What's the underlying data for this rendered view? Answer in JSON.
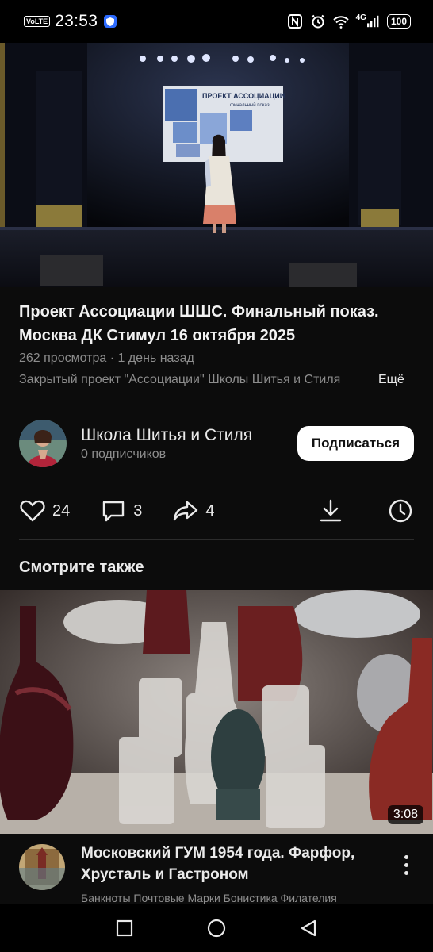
{
  "status_bar": {
    "volte": "VoLTE",
    "time": "23:53",
    "network": "4G",
    "battery": "100",
    "icons": [
      "vpn-icon",
      "nfc-icon",
      "alarm-icon",
      "wifi-icon",
      "signal-icon",
      "battery-icon"
    ]
  },
  "video": {
    "screen_text": "ПРОЕКТ АССОЦИАЦИИ",
    "screen_subtext": "финальный показ"
  },
  "title": "Проект Ассоциации ШШС. Финальный показ. Москва ДК Стимул 16 октября 2025",
  "meta": "262 просмотра · 1 день назад",
  "description": "Закрытый проект \"Ассоциации\" Школы Шитья и Стиля",
  "more_label": "Ещё",
  "channel": {
    "name": "Школа Шитья и Стиля",
    "subscribers": "0 подписчиков",
    "subscribe_label": "Подписаться"
  },
  "actions": {
    "likes": "24",
    "comments": "3",
    "shares": "4",
    "icons": [
      "heart-icon",
      "comment-icon",
      "share-icon",
      "download-icon",
      "clock-icon"
    ]
  },
  "related_section_title": "Смотрите также",
  "related": {
    "duration": "3:08",
    "title": "Московский ГУМ 1954 года. Фарфор, Хрусталь и Гастроном",
    "channel": "Банкноты Почтовые Марки Бонистика Филателия"
  },
  "navbar": {
    "icons": [
      "recents-icon",
      "home-icon",
      "back-icon"
    ]
  },
  "colors": {
    "background": "#0c0c0c",
    "text_primary": "#eaeaea",
    "text_secondary": "#8d8d8d",
    "subscribe_bg": "#ffffff"
  }
}
